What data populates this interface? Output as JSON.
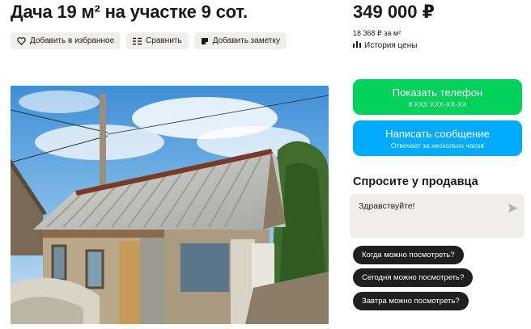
{
  "listing": {
    "title": "Дача 19 м² на участке 9 сот.",
    "price": "349 000 ₽",
    "price_per_m2": "18 368 ₽ за м²",
    "price_history_label": "История цены"
  },
  "actions": {
    "favorite_label": "Добавить в избранное",
    "compare_label": "Сравнить",
    "note_label": "Добавить заметку"
  },
  "contact": {
    "show_phone_label": "Показать телефон",
    "show_phone_sub": "8 XXX XXX-XX-XX",
    "write_label": "Написать сообщение",
    "write_sub": "Отвечает за несколько часов"
  },
  "ask_seller": {
    "title": "Спросите у продавца",
    "message_value": "Здравствуйте!",
    "quick_questions": [
      "Когда можно посмотреть?",
      "Сегодня можно посмотреть?",
      "Завтра можно посмотреть?"
    ]
  },
  "colors": {
    "phone_button": "#02d15c",
    "message_button": "#00aaff",
    "chip_bg": "#f1efec",
    "quick_chip_bg": "#1f1f1f"
  },
  "icons": [
    "heart-icon",
    "compare-icon",
    "note-icon",
    "chart-icon",
    "send-icon"
  ]
}
